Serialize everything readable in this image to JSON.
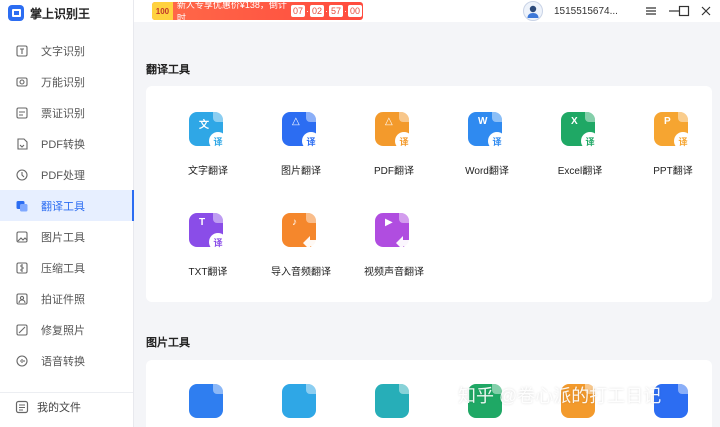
{
  "app": {
    "title": "掌上识别王"
  },
  "sidebar": {
    "items": [
      {
        "label": "文字识别",
        "icon": "text-recognition-icon"
      },
      {
        "label": "万能识别",
        "icon": "universal-recognition-icon"
      },
      {
        "label": "票证识别",
        "icon": "ticket-recognition-icon"
      },
      {
        "label": "PDF转换",
        "icon": "pdf-convert-icon"
      },
      {
        "label": "PDF处理",
        "icon": "pdf-process-icon"
      },
      {
        "label": "翻译工具",
        "icon": "translate-icon"
      },
      {
        "label": "图片工具",
        "icon": "image-tool-icon"
      },
      {
        "label": "压缩工具",
        "icon": "compress-icon"
      },
      {
        "label": "拍证件照",
        "icon": "id-photo-icon"
      },
      {
        "label": "修复照片",
        "icon": "photo-repair-icon"
      },
      {
        "label": "语音转换",
        "icon": "voice-convert-icon"
      }
    ],
    "active_index": 5,
    "my_files": "我的文件"
  },
  "topbar": {
    "promo_badge": "100",
    "promo_text": "新人专享优惠价¥138，倒计时",
    "countdown": [
      "07",
      "02",
      "57",
      "00"
    ],
    "username": "1515515674..."
  },
  "sections": {
    "translate": {
      "title": "翻译工具",
      "tools": [
        {
          "label": "文字翻译",
          "color": "#2fa7e6",
          "glyph": "文"
        },
        {
          "label": "图片翻译",
          "color": "#2c6df2",
          "glyph": "△"
        },
        {
          "label": "PDF翻译",
          "color": "#f39a2c",
          "glyph": "△"
        },
        {
          "label": "Word翻译",
          "color": "#2f8af0",
          "glyph": "W"
        },
        {
          "label": "Excel翻译",
          "color": "#1fa865",
          "glyph": "X"
        },
        {
          "label": "PPT翻译",
          "color": "#f6a531",
          "glyph": "P"
        },
        {
          "label": "TXT翻译",
          "color": "#8a4de8",
          "glyph": "T"
        },
        {
          "label": "导入音频翻译",
          "color": "#f5872c",
          "glyph": "♪"
        },
        {
          "label": "视频声音翻译",
          "color": "#b04de0",
          "glyph": "▶"
        }
      ],
      "badge_text": "译"
    },
    "image": {
      "title": "图片工具",
      "tool_colors": [
        "#2f7ef0",
        "#2fa7e6",
        "#27aeb8",
        "#1fa865",
        "#f39a2c",
        "#2c6df2"
      ]
    }
  },
  "watermark": "知乎 @卷心派的打工日记"
}
